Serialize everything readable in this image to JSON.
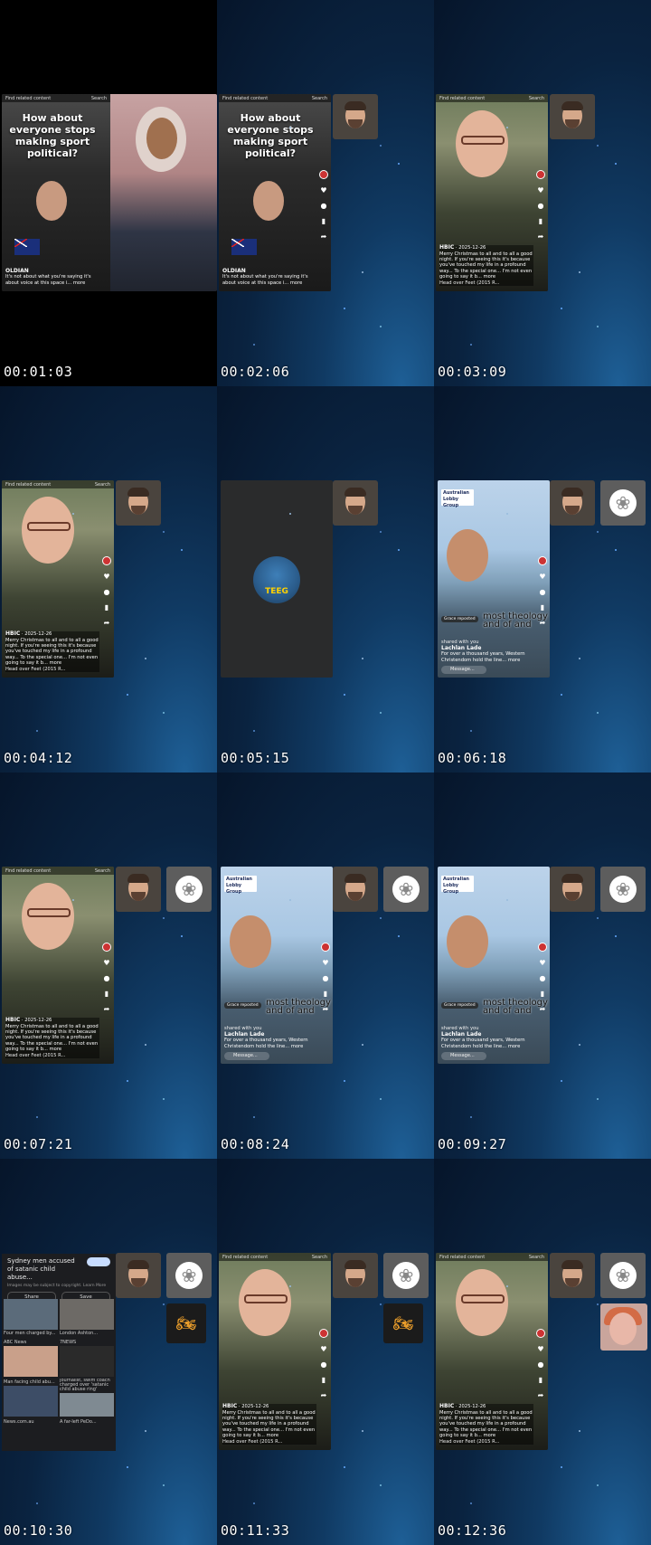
{
  "timestamps": [
    "00:01:03",
    "00:02:06",
    "00:03:09",
    "00:04:12",
    "00:05:15",
    "00:06:18",
    "00:07:21",
    "00:08:24",
    "00:09:27",
    "00:10:30",
    "00:11:33",
    "00:12:36"
  ],
  "topbar": {
    "find": "Find related content",
    "search": "Search"
  },
  "sport_video": {
    "headline": "How about everyone stops making sport political?",
    "user": "OLDIAN",
    "caption": "It's not about what you're saying it's about voice at this space i... more"
  },
  "woman_video": {
    "user": "HBIC",
    "date": "2025-12-26",
    "caption": "Merry Christmas to all and to all a good night. If you're seeing this it's because you've touched my life in a profound way... To the special one... I'm not even going to say it b... more",
    "sound": "Head over Feet (2015 R..."
  },
  "lake_video": {
    "banner": "Australian Lobby Group",
    "reposted": "Grace reposted",
    "shared": "shared with you",
    "overlay": "most theology and of and",
    "user": "Lachlan Lade",
    "caption": "For over a thousand years, Western Christendom hold the line... more",
    "message": "Message..."
  },
  "loader_text": "TEEG",
  "search_panel": {
    "title": "Sydney men accused of satanic child abuse...",
    "note": "Images may be subject to copyright. Learn More",
    "share": "Share",
    "save": "Save",
    "thumbs": [
      {
        "caption": "Four men charged by..."
      },
      {
        "caption": "London Ashton..."
      },
      {
        "caption": "ABC News"
      },
      {
        "caption": "7NEWS"
      },
      {
        "caption": "Man facing child abu..."
      },
      {
        "caption": "Journalist, swim coach charged over 'satanic child abuse ring'"
      },
      {
        "caption": "News.com.au"
      },
      {
        "caption": "A far-left PeDo..."
      }
    ]
  },
  "icons": [
    "person-tile-icon",
    "circle-logo-icon",
    "motorbike-icon",
    "woman-tile-icon"
  ]
}
